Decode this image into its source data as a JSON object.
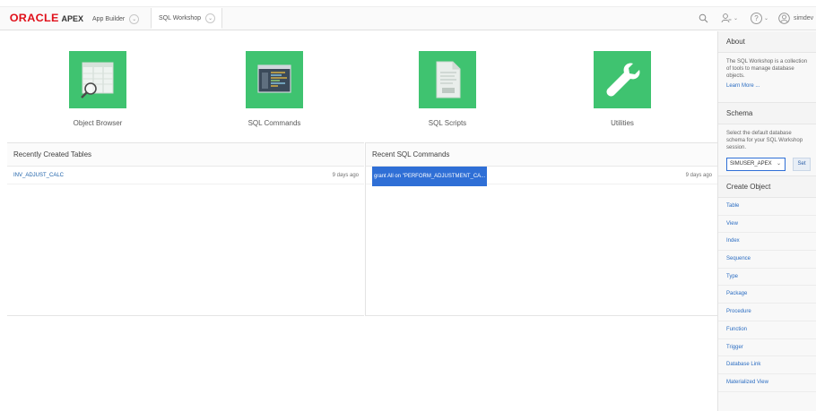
{
  "header": {
    "logo_oracle": "ORACLE",
    "logo_apex": "APEX",
    "tabs": [
      {
        "label": "App Builder"
      },
      {
        "label": "SQL Workshop"
      }
    ],
    "username": "simdev",
    "icons": {
      "search": "search-icon",
      "admin": "user-admin-icon",
      "help": "help-icon",
      "account": "account-icon"
    }
  },
  "tiles": [
    {
      "label": "Object Browser",
      "icon": "object-browser-icon"
    },
    {
      "label": "SQL Commands",
      "icon": "sql-commands-icon"
    },
    {
      "label": "SQL Scripts",
      "icon": "sql-scripts-icon"
    },
    {
      "label": "Utilities",
      "icon": "utilities-icon"
    }
  ],
  "recent_tables": {
    "title": "Recently Created Tables",
    "rows": [
      {
        "name": "INV_ADJUST_CALC",
        "when": "9 days ago"
      }
    ]
  },
  "recent_sql": {
    "title": "Recent SQL Commands",
    "rows": [
      {
        "name": "grant All on \"PERFORM_ADJUSTMENT_CA...",
        "when": "9 days ago"
      }
    ]
  },
  "sidebar": {
    "about": {
      "title": "About",
      "text": "The SQL Workshop is a collection of tools to manage database objects.",
      "link": "Learn More ..."
    },
    "schema": {
      "title": "Schema",
      "text": "Select the default database schema for your SQL Workshop session.",
      "selected": "SIMUSER_APEX",
      "set_label": "Set"
    },
    "create_object": {
      "title": "Create Object",
      "items": [
        "Table",
        "View",
        "Index",
        "Sequence",
        "Type",
        "Package",
        "Procedure",
        "Function",
        "Trigger",
        "Database Link",
        "Materialized View"
      ]
    }
  },
  "colors": {
    "tile_green": "#3fc370",
    "oracle_red": "#e0101a",
    "link_blue": "#2b6dc2",
    "selection_blue": "#2f6fd6"
  }
}
